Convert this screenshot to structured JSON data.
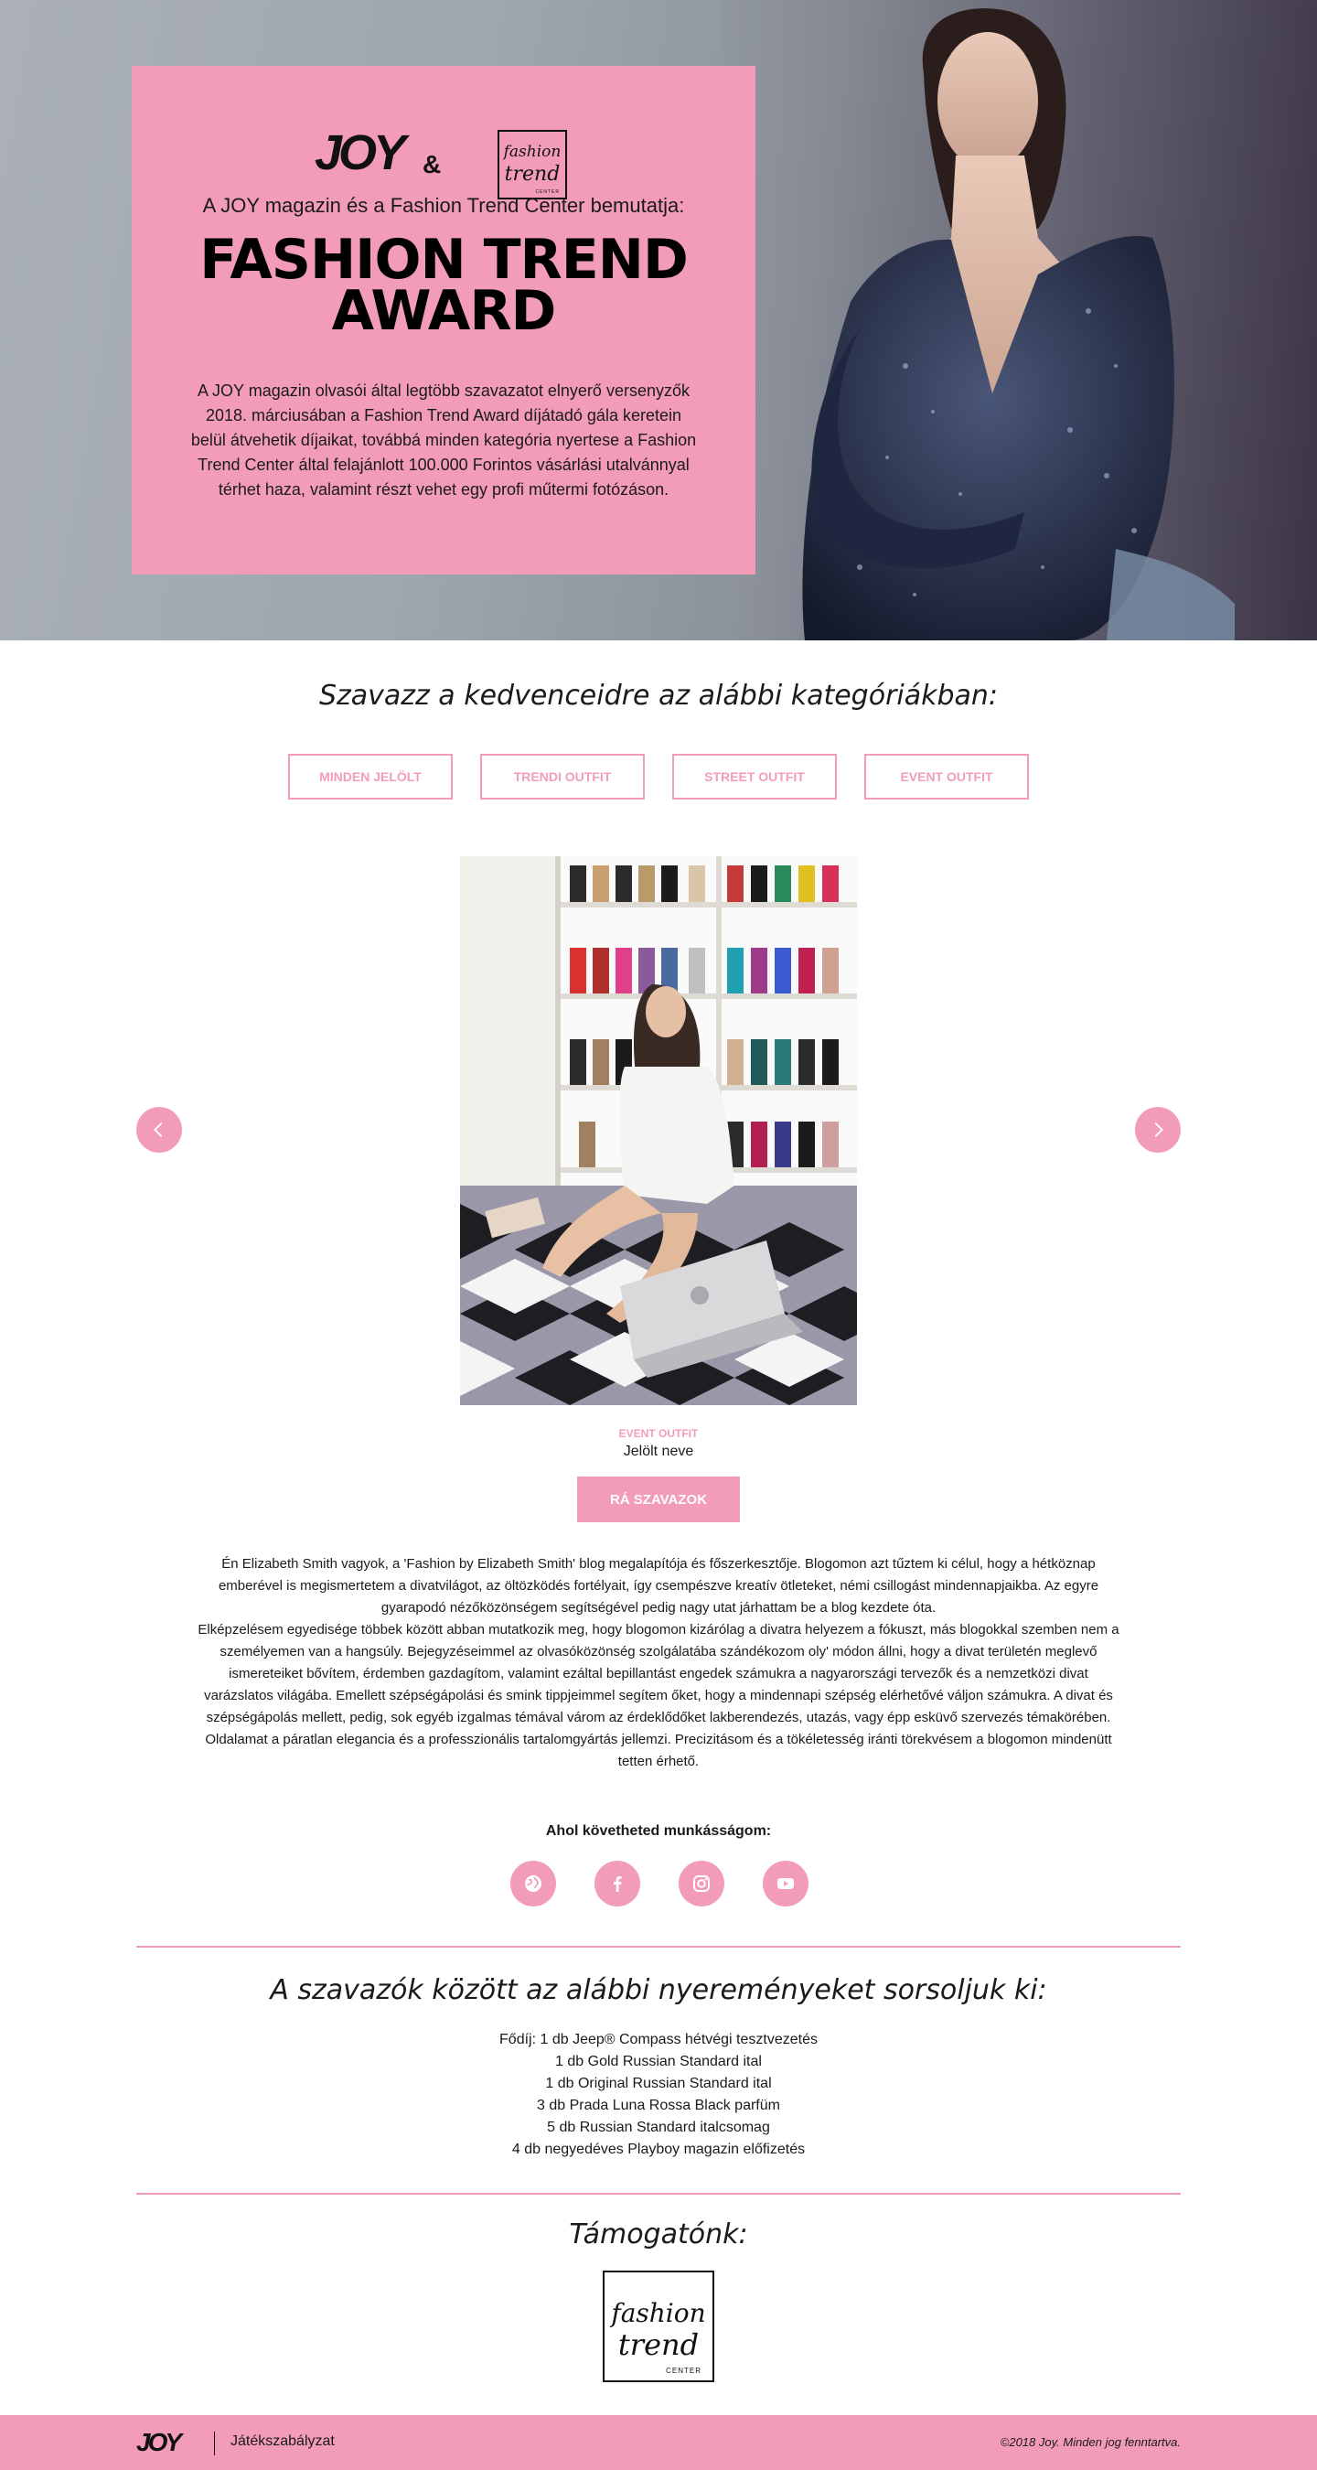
{
  "colors": {
    "accent": "#f39cb8",
    "text": "#1a1a1a"
  },
  "hero": {
    "brand_joy": "JOY",
    "brand_amp": "&",
    "ftc_line1": "fashion",
    "ftc_line2": "trend",
    "ftc_line3": "CENTER",
    "intro": "A JOY magazin és a Fashion Trend Center bemutatja:",
    "title_line1": "FASHION TREND",
    "title_line2": "AWARD",
    "description": "A JOY magazin olvasói által legtöbb szavazatot elnyerő versenyzők 2018. márciusában a Fashion Trend Award díjátadó gála keretein belül átvehetik díjaikat, továbbá minden kategória nyertese a Fashion Trend Center által felajánlott 100.000 Forintos vásárlási utalvánnyal térhet haza, valamint részt vehet egy profi műtermi fotózáson."
  },
  "vote": {
    "heading": "Szavazz a kedvenceidre az alábbi kategóriákban:",
    "tabs": [
      "MINDEN JELÖLT",
      "TRENDI OUTFIT",
      "STREET OUTFIT",
      "EVENT OUTFIT"
    ],
    "prev_icon": "chevron-left-icon",
    "next_icon": "chevron-right-icon",
    "candidate": {
      "category": "EVENT OUTFIT",
      "name": "Jelölt neve",
      "vote_label": "RÁ SZAVAZOK",
      "bio": [
        "Én Elizabeth Smith vagyok, a 'Fashion by Elizabeth Smith' blog megalapítója és főszerkesztője. Blogomon azt tűztem ki célul, hogy a hétköznap emberével is megismertetem a divatvilágot, az öltözködés fortélyait, így csempészve kreatív ötleteket, némi csillogást mindennapjaikba. Az egyre gyarapodó nézőközönségem segítségével pedig nagy utat járhattam be a blog kezdete óta.",
        "Elképzelésem egyedisége többek között abban mutatkozik meg, hogy blogomon kizárólag a divatra helyezem a fókuszt, más blogokkal szemben nem a személyemen van a hangsúly. Bejegyzéseimmel az olvasóközönség szolgálatába szándékozom oly' módon állni, hogy a divat területén meglevő ismereteiket bővítem, érdemben gazdagítom, valamint ezáltal bepillantást engedek számukra a nagyarországi tervezők és a nemzetközi divat varázslatos világába. Emellett szépségápolási és smink tippjeimmel segítem őket, hogy a mindennapi szépség elérhetővé váljon számukra. A divat és szépségápolás mellett, pedig, sok egyéb izgalmas témával várom az érdeklődőket lakberendezés, utazás, vagy épp esküvő szervezés témakörében.",
        "Oldalamat a páratlan elegancia és a professzionális tartalomgyártás jellemzi. Precizitásom és a tökéletesség iránti törekvésem a blogomon mindenütt tetten érhető."
      ],
      "follow_label": "Ahol követheted munkásságom:",
      "socials": [
        "globe-icon",
        "facebook-icon",
        "instagram-icon",
        "youtube-icon"
      ]
    }
  },
  "prizes": {
    "heading": "A szavazók között az alábbi nyereményeket sorsoljuk ki:",
    "items": [
      "Fődíj: 1 db Jeep® Compass hétvégi tesztvezetés",
      "1 db Gold Russian Standard ital",
      "1 db Original Russian Standard ital",
      "3 db Prada Luna Rossa Black parfüm",
      "5 db Russian Standard italcsomag",
      "4 db negyedéves Playboy magazin előfizetés"
    ]
  },
  "sponsor": {
    "heading": "Támogatónk:",
    "ftc_line1": "fashion",
    "ftc_line2": "trend",
    "ftc_line3": "CENTER"
  },
  "footer": {
    "logo": "JOY",
    "rules_link": "Játékszabályzat",
    "copyright": "©2018 Joy. Minden jog fenntartva."
  }
}
